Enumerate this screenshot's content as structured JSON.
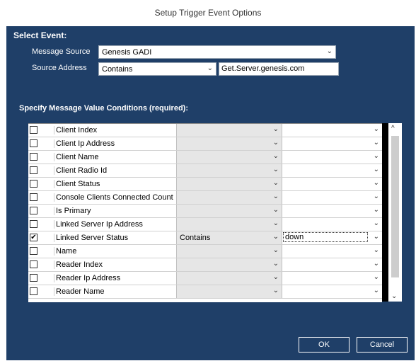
{
  "window": {
    "title": "Setup Trigger Event Options"
  },
  "select_event": {
    "heading": "Select Event:",
    "message_source_label": "Message Source",
    "message_source_value": "Genesis GADI",
    "source_address_label": "Source Address",
    "source_address_operator": "Contains",
    "source_address_value": "Get.Server.genesis.com"
  },
  "conditions": {
    "heading": "Specify Message Value Conditions (required):",
    "rows": [
      {
        "checked": "",
        "name": "Client Index",
        "operator": "",
        "value": ""
      },
      {
        "checked": "",
        "name": "Client Ip Address",
        "operator": "",
        "value": ""
      },
      {
        "checked": "",
        "name": "Client Name",
        "operator": "",
        "value": ""
      },
      {
        "checked": "",
        "name": "Client Radio Id",
        "operator": "",
        "value": ""
      },
      {
        "checked": "",
        "name": "Client Status",
        "operator": "",
        "value": ""
      },
      {
        "checked": "",
        "name": "Console Clients Connected Count",
        "operator": "",
        "value": ""
      },
      {
        "checked": "",
        "name": "Is Primary",
        "operator": "",
        "value": ""
      },
      {
        "checked": "",
        "name": "Linked Server Ip Address",
        "operator": "",
        "value": ""
      },
      {
        "checked": "✔",
        "name": "Linked Server Status",
        "operator": "Contains",
        "value": "down"
      },
      {
        "checked": "",
        "name": "Name",
        "operator": "",
        "value": ""
      },
      {
        "checked": "",
        "name": "Reader Index",
        "operator": "",
        "value": ""
      },
      {
        "checked": "",
        "name": "Reader Ip Address",
        "operator": "",
        "value": ""
      },
      {
        "checked": "",
        "name": "Reader Name",
        "operator": "",
        "value": ""
      }
    ]
  },
  "buttons": {
    "ok": "OK",
    "cancel": "Cancel"
  },
  "colors": {
    "panel": "#1f3f68"
  }
}
